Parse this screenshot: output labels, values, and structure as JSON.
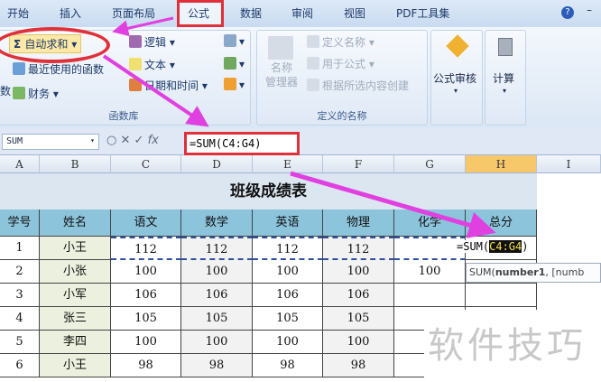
{
  "tabs": [
    "开始",
    "插入",
    "页面布局",
    "公式",
    "数据",
    "审阅",
    "视图",
    "PDF工具集"
  ],
  "active_tab": "公式",
  "ribbon": {
    "autosum": "自动求和",
    "recent": "最近使用的函数",
    "finance": "财务",
    "logic": "逻辑",
    "text": "文本",
    "datetime": "日期和时间",
    "insert_fn_partial": "数",
    "func_lib": "函数库",
    "name_mgr": "名称\n管理器",
    "define_name": "定义名称",
    "use_in_formula": "用于公式",
    "create_from_sel": "根据所选内容创建",
    "defined_names": "定义的名称",
    "audit": "公式审核",
    "calc": "计算"
  },
  "formula_bar": {
    "name_box": "SUM",
    "formula": "=SUM(C4:G4)",
    "fx": "fx"
  },
  "columns": [
    "A",
    "B",
    "C",
    "D",
    "E",
    "F",
    "G",
    "H",
    "I"
  ],
  "sheet": {
    "title": "班级成绩表",
    "headers": [
      "学号",
      "姓名",
      "语文",
      "数学",
      "英语",
      "物理",
      "化学",
      "总分"
    ],
    "rows": [
      [
        "1",
        "小王",
        "112",
        "112",
        "112",
        "112",
        "",
        ""
      ],
      [
        "2",
        "小张",
        "100",
        "100",
        "100",
        "100",
        "100",
        ""
      ],
      [
        "3",
        "小军",
        "106",
        "106",
        "106",
        "106",
        "",
        ""
      ],
      [
        "4",
        "张三",
        "105",
        "105",
        "105",
        "105",
        "",
        ""
      ],
      [
        "5",
        "李四",
        "100",
        "100",
        "100",
        "100",
        "",
        ""
      ],
      [
        "6",
        "小王",
        "98",
        "98",
        "98",
        "98",
        "",
        ""
      ]
    ],
    "editing_prefix": "=SUM(",
    "editing_ref": "C4:G4",
    "editing_suffix": ")"
  },
  "tooltip": {
    "fn": "SUM(",
    "arg": "number1",
    ",rest": ", [numb"
  },
  "watermark": "软件技巧",
  "colors": {
    "highlight": "#e0303a",
    "arrow": "#e040e0",
    "header_fill": "#8cc4dc",
    "name_fill": "#ebf1de"
  }
}
